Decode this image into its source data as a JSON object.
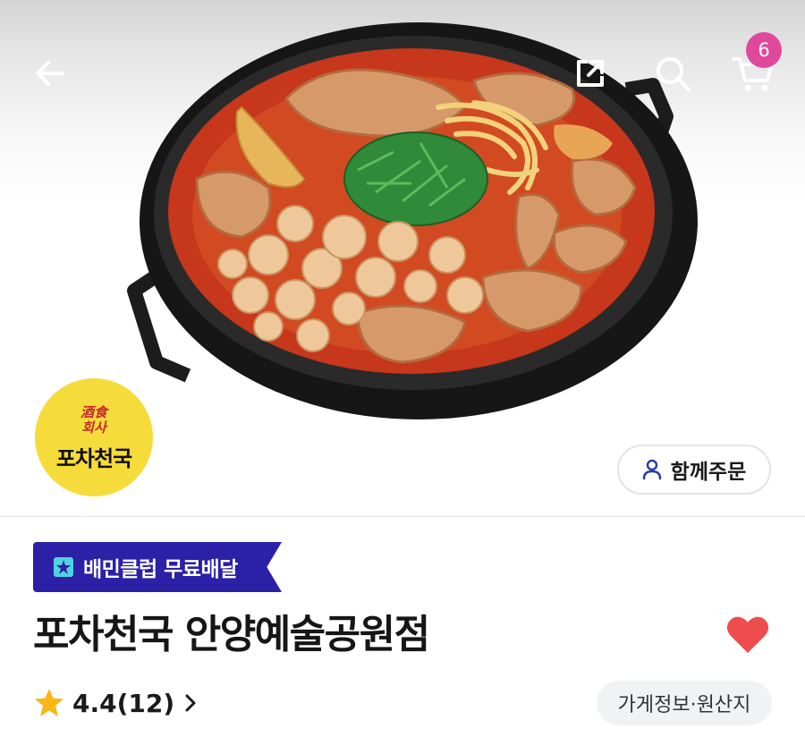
{
  "hero": {
    "image_alt": "dakbokkeumtang stew in black pan"
  },
  "header": {
    "back_icon": "back-arrow-icon",
    "share_icon": "share-icon",
    "search_icon": "search-icon",
    "cart_icon": "cart-icon",
    "cart_count": "6",
    "badge_color": "#e0489b"
  },
  "store": {
    "logo_seal_top": "酒食",
    "logo_seal_bottom": "회사",
    "logo_name": "포차천국",
    "logo_color": "#f6dc3b",
    "group_order_label": "함께주문",
    "club_badge_label": "배민클럽 무료배달",
    "club_badge_color": "#2b20a6",
    "name": "포차천국 안양예술공원점",
    "favorite_color": "#ee4d4d",
    "rating": "4.4(12)",
    "info_label": "가게정보·원산지"
  }
}
